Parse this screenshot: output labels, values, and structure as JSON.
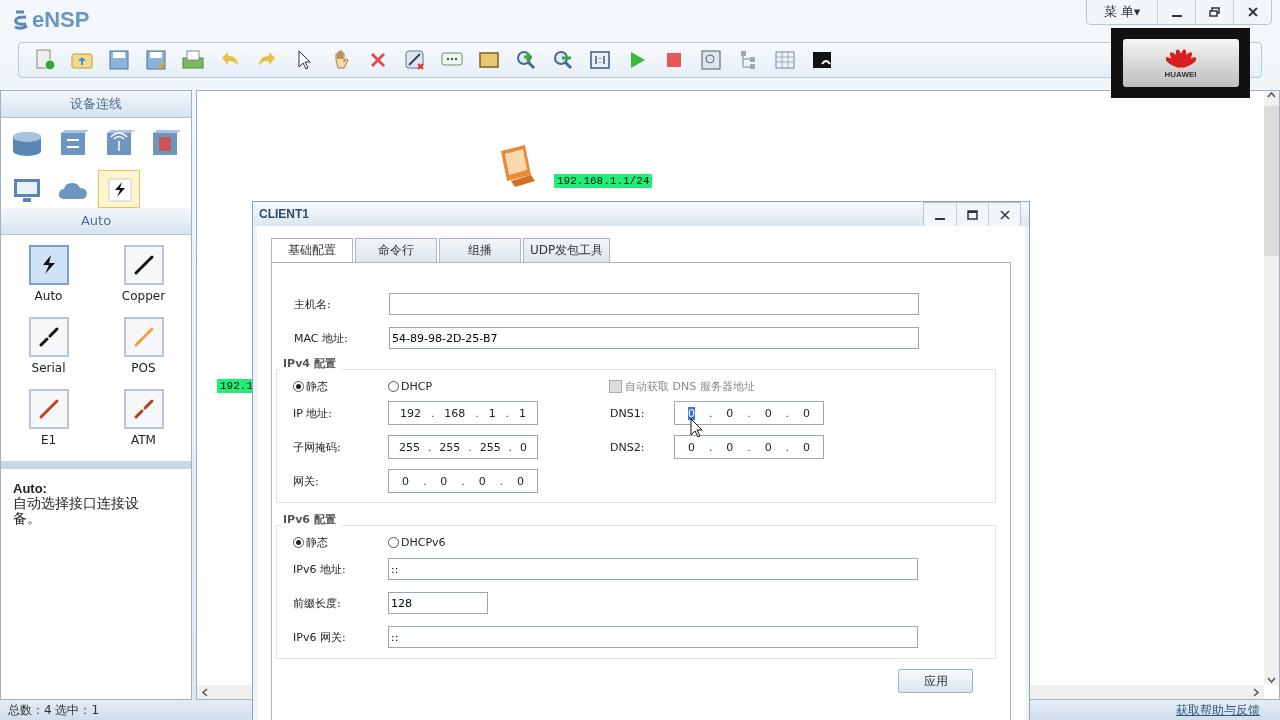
{
  "window": {
    "title": "eNSP",
    "menu": "菜 单▾"
  },
  "brand_logo": {
    "text": "HUAWEI"
  },
  "device_panel": {
    "title": "设备连线",
    "categories": [
      {
        "kind": "router",
        "selected": false
      },
      {
        "kind": "switch",
        "selected": false
      },
      {
        "kind": "wireless",
        "selected": false
      },
      {
        "kind": "firewall",
        "selected": false
      },
      {
        "kind": "terminal",
        "selected": false
      },
      {
        "kind": "cloud",
        "selected": false
      },
      {
        "kind": "cable",
        "selected": true
      }
    ],
    "subtitle": "Auto",
    "cables": [
      {
        "label": "Auto",
        "kind": "auto",
        "selected": true
      },
      {
        "label": "Copper",
        "kind": "copper",
        "selected": false
      },
      {
        "label": "Serial",
        "kind": "serial",
        "selected": false
      },
      {
        "label": "POS",
        "kind": "pos",
        "selected": false
      },
      {
        "label": "E1",
        "kind": "e1",
        "selected": false
      },
      {
        "label": "ATM",
        "kind": "atm",
        "selected": false
      }
    ],
    "description": {
      "title": "Auto:",
      "text": "自动选择接口连接设备。"
    }
  },
  "canvas": {
    "labels": [
      "192.168.1.1/24",
      "192.1"
    ]
  },
  "dialog": {
    "title": "CLIENT1",
    "tabs": [
      {
        "label": "基础配置",
        "selected": true
      },
      {
        "label": "命令行",
        "selected": false
      },
      {
        "label": "组播",
        "selected": false
      },
      {
        "label": "UDP发包工具",
        "selected": false
      }
    ],
    "hostname": {
      "label": "主机名:"
    },
    "mac": {
      "label": "MAC 地址:",
      "value": "54-89-98-2D-25-B7"
    },
    "ipv4": {
      "title": "IPv4 配置",
      "separator": ".",
      "modes": [
        {
          "label": "静态",
          "selected": true
        },
        {
          "label": "DHCP",
          "selected": false
        }
      ],
      "auto_dns": {
        "label": "自动获取 DNS 服务器地址",
        "checked": false,
        "disabled": true
      },
      "ip": {
        "label": "IP 地址:",
        "octets": [
          "192",
          "168",
          "1",
          "1"
        ]
      },
      "mask": {
        "label": "子网掩码:",
        "octets": [
          "255",
          "255",
          "255",
          "0"
        ]
      },
      "gateway": {
        "label": "网关:",
        "octets": [
          "0",
          "0",
          "0",
          "0"
        ]
      },
      "dns1": {
        "label": "DNS1:",
        "octets": [
          "0",
          "0",
          "0",
          "0"
        ],
        "focused": true
      },
      "dns2": {
        "label": "DNS2:",
        "octets": [
          "0",
          "0",
          "0",
          "0"
        ],
        "focused": false
      }
    },
    "ipv6": {
      "title": "IPv6 配置",
      "modes": [
        {
          "label": "静态",
          "selected": true
        },
        {
          "label": "DHCPv6",
          "selected": false
        }
      ],
      "address": {
        "label": "IPv6 地址:",
        "value": "::"
      },
      "prefix": {
        "label": "前缀长度:",
        "value": "128"
      },
      "gateway": {
        "label": "IPv6 网关:",
        "value": "::"
      }
    },
    "apply": "应用"
  },
  "status_bar": {
    "counts": "总数：4  选中：1",
    "help_link": "获取帮助与反馈"
  }
}
